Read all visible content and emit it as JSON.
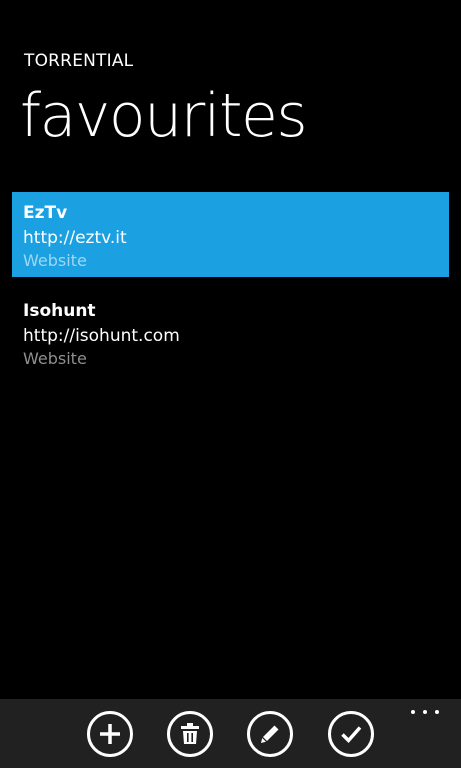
{
  "header": {
    "app_title": "TORRENTIAL",
    "page_title": "favourites"
  },
  "favourites": [
    {
      "name": "EzTv",
      "url": "http://eztv.it",
      "type": "Website",
      "selected": true
    },
    {
      "name": "Isohunt",
      "url": "http://isohunt.com",
      "type": "Website",
      "selected": false
    }
  ],
  "app_bar": {
    "buttons": [
      {
        "icon": "add-icon"
      },
      {
        "icon": "delete-icon"
      },
      {
        "icon": "edit-icon"
      },
      {
        "icon": "check-icon"
      }
    ],
    "more_icon": "ellipsis-icon"
  },
  "colors": {
    "background": "#000000",
    "accent": "#1ba1e2",
    "app_bar": "#212121",
    "secondary_text": "#8f8f8f"
  }
}
